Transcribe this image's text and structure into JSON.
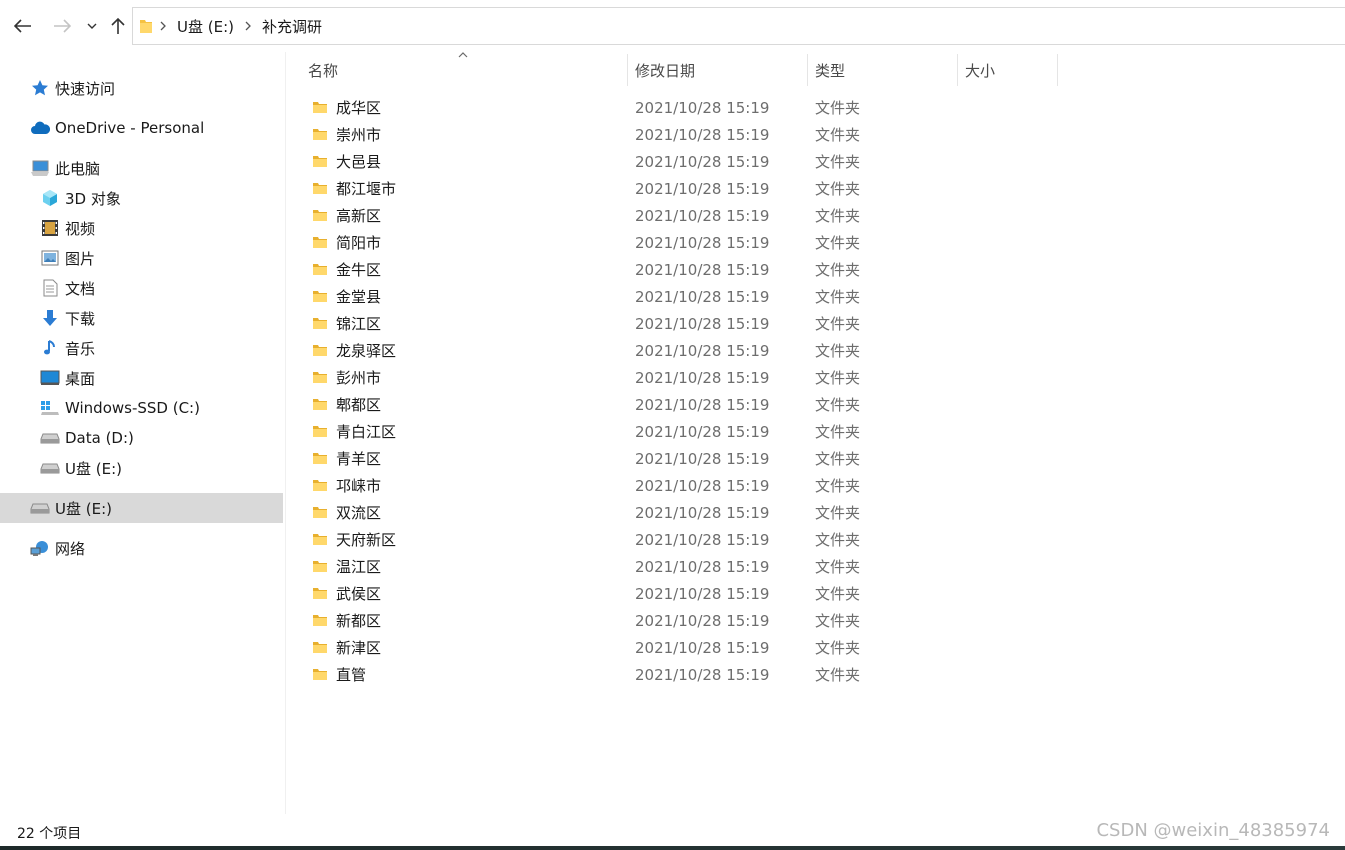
{
  "address": {
    "crumbs": [
      "U盘 (E:)",
      "补充调研"
    ]
  },
  "nav": {
    "quick_access": "快速访问",
    "onedrive": "OneDrive - Personal",
    "this_pc": "此电脑",
    "pc_items": [
      "3D 对象",
      "视频",
      "图片",
      "文档",
      "下载",
      "音乐",
      "桌面",
      "Windows-SSD (C:)",
      "Data (D:)",
      "U盘 (E:)"
    ],
    "usb": "U盘 (E:)",
    "network": "网络"
  },
  "columns": {
    "name": "名称",
    "date": "修改日期",
    "type": "类型",
    "size": "大小"
  },
  "files": [
    {
      "name": "成华区",
      "date": "2021/10/28 15:19",
      "type": "文件夹"
    },
    {
      "name": "崇州市",
      "date": "2021/10/28 15:19",
      "type": "文件夹"
    },
    {
      "name": "大邑县",
      "date": "2021/10/28 15:19",
      "type": "文件夹"
    },
    {
      "name": "都江堰市",
      "date": "2021/10/28 15:19",
      "type": "文件夹"
    },
    {
      "name": "高新区",
      "date": "2021/10/28 15:19",
      "type": "文件夹"
    },
    {
      "name": "简阳市",
      "date": "2021/10/28 15:19",
      "type": "文件夹"
    },
    {
      "name": "金牛区",
      "date": "2021/10/28 15:19",
      "type": "文件夹"
    },
    {
      "name": "金堂县",
      "date": "2021/10/28 15:19",
      "type": "文件夹"
    },
    {
      "name": "锦江区",
      "date": "2021/10/28 15:19",
      "type": "文件夹"
    },
    {
      "name": "龙泉驿区",
      "date": "2021/10/28 15:19",
      "type": "文件夹"
    },
    {
      "name": "彭州市",
      "date": "2021/10/28 15:19",
      "type": "文件夹"
    },
    {
      "name": "郫都区",
      "date": "2021/10/28 15:19",
      "type": "文件夹"
    },
    {
      "name": "青白江区",
      "date": "2021/10/28 15:19",
      "type": "文件夹"
    },
    {
      "name": "青羊区",
      "date": "2021/10/28 15:19",
      "type": "文件夹"
    },
    {
      "name": "邛崃市",
      "date": "2021/10/28 15:19",
      "type": "文件夹"
    },
    {
      "name": "双流区",
      "date": "2021/10/28 15:19",
      "type": "文件夹"
    },
    {
      "name": "天府新区",
      "date": "2021/10/28 15:19",
      "type": "文件夹"
    },
    {
      "name": "温江区",
      "date": "2021/10/28 15:19",
      "type": "文件夹"
    },
    {
      "name": "武侯区",
      "date": "2021/10/28 15:19",
      "type": "文件夹"
    },
    {
      "name": "新都区",
      "date": "2021/10/28 15:19",
      "type": "文件夹"
    },
    {
      "name": "新津区",
      "date": "2021/10/28 15:19",
      "type": "文件夹"
    },
    {
      "name": "直管",
      "date": "2021/10/28 15:19",
      "type": "文件夹"
    }
  ],
  "status": {
    "count_text": "22 个项目"
  },
  "watermark": "CSDN @weixin_48385974",
  "colors": {
    "folder": "#f5c242",
    "accent": "#0078d4",
    "selected": "#d9d9d9"
  }
}
